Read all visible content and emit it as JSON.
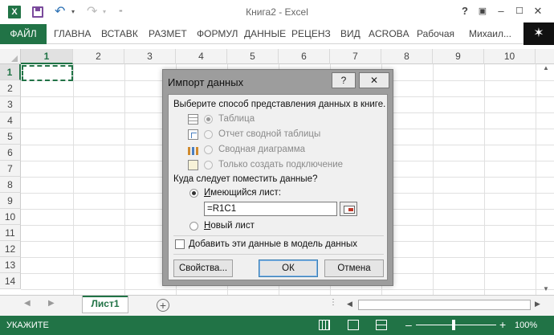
{
  "window": {
    "title": "Книга2 - Excel",
    "app_icon_label": "X",
    "help_label": "?",
    "ribbon_toggle_label": "▣",
    "minimize_label": "–",
    "maximize_label": "☐",
    "close_label": "✕"
  },
  "quick_access": {
    "undo_label": "↶",
    "redo_label": "↷",
    "dropdown_label": "▾",
    "more_label": "⁼"
  },
  "ribbon": {
    "tabs": [
      "ФАЙЛ",
      "ГЛАВНА",
      "ВСТАВК",
      "РАЗМЕТ",
      "ФОРМУЛ",
      "ДАННЫЕ",
      "РЕЦЕНЗ",
      "ВИД",
      "ACROBA",
      "Рабочая",
      "Михаил..."
    ],
    "user_badge": "✶"
  },
  "sheet": {
    "columns": [
      "1",
      "2",
      "3",
      "4",
      "5",
      "6",
      "7",
      "8",
      "9",
      "10"
    ],
    "rows": [
      "1",
      "2",
      "3",
      "4",
      "5",
      "6",
      "7",
      "8",
      "9",
      "10",
      "11",
      "12",
      "13",
      "14"
    ],
    "active_column": "1",
    "active_row": "1"
  },
  "sheet_tabs": {
    "prev_label": "◀",
    "next_label": "▶",
    "active_tab": "Лист1",
    "add_label": "+",
    "scroll_left": "◀",
    "scroll_right": "▶",
    "dots": "⋮",
    "scroll_up": "▲",
    "scroll_down": "▼"
  },
  "status_bar": {
    "mode": "УКАЖИТЕ",
    "zoom_minus": "–",
    "zoom_plus": "+",
    "zoom_level": "100%",
    "zoom_fraction": 0.5
  },
  "dialog": {
    "title": "Импорт данных",
    "help_label": "?",
    "close_label": "✕",
    "view_prompt": "Выберите способ представления данных в книге.",
    "view_options": [
      {
        "label": "Таблица",
        "icon": "table-icon",
        "checked": true,
        "enabled": false
      },
      {
        "label": "Отчет сводной таблицы",
        "icon": "pivot-table-icon",
        "checked": false,
        "enabled": false
      },
      {
        "label": "Сводная диаграмма",
        "icon": "pivot-chart-icon",
        "checked": false,
        "enabled": false
      },
      {
        "label": "Только создать подключение",
        "icon": "connection-icon",
        "checked": false,
        "enabled": false
      }
    ],
    "location_prompt": "Куда следует поместить данные?",
    "existing_sheet_label": "Имеющийся лист:",
    "existing_sheet_checked": true,
    "reference_value": "=R1C1",
    "new_sheet_label": "Новый лист",
    "add_to_model_label": "Добавить эти данные в модель данных",
    "properties_button": "Свойства...",
    "ok_button": "ОК",
    "cancel_button": "Отмена"
  }
}
